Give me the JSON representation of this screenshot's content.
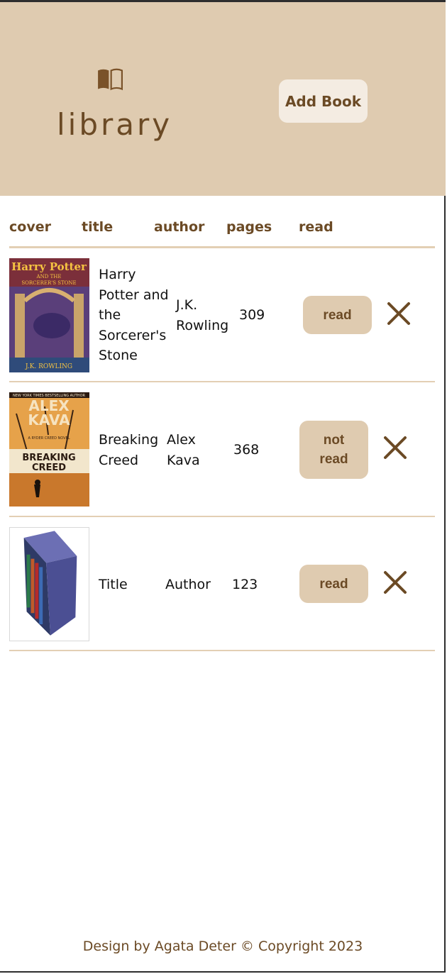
{
  "header": {
    "logo_text": "library",
    "add_book_label": "Add Book"
  },
  "table": {
    "columns": [
      "cover",
      "title",
      "author",
      "pages",
      "read"
    ],
    "rows": [
      {
        "title": "Harry Potter and the Sorcerer's Stone",
        "author": "J.K. Rowling",
        "pages": "309",
        "read_label": "read",
        "cover_text": [
          "Harry Potter",
          "AND THE",
          "SORCERER'S STONE",
          "J.K. ROWLING"
        ]
      },
      {
        "title": "Breaking Creed",
        "author": "Alex Kava",
        "pages": "368",
        "read_label": "not read",
        "cover_text": [
          "NEW YORK TIMES BESTSELLING AUTHOR",
          "ALEX",
          "KAVA",
          "A RYDER CREED NOVEL",
          "BREAKING",
          "CREED"
        ]
      },
      {
        "title": "Title",
        "author": "Author",
        "pages": "123",
        "read_label": "read",
        "cover_text": []
      }
    ]
  },
  "footer": {
    "text": "Design by Agata Deter © Copyright 2023"
  },
  "colors": {
    "header_bg": "#dfcbb0",
    "accent_brown": "#6b4a25",
    "button_bg": "#dfcbb0",
    "add_button_bg": "#f4ece2"
  }
}
